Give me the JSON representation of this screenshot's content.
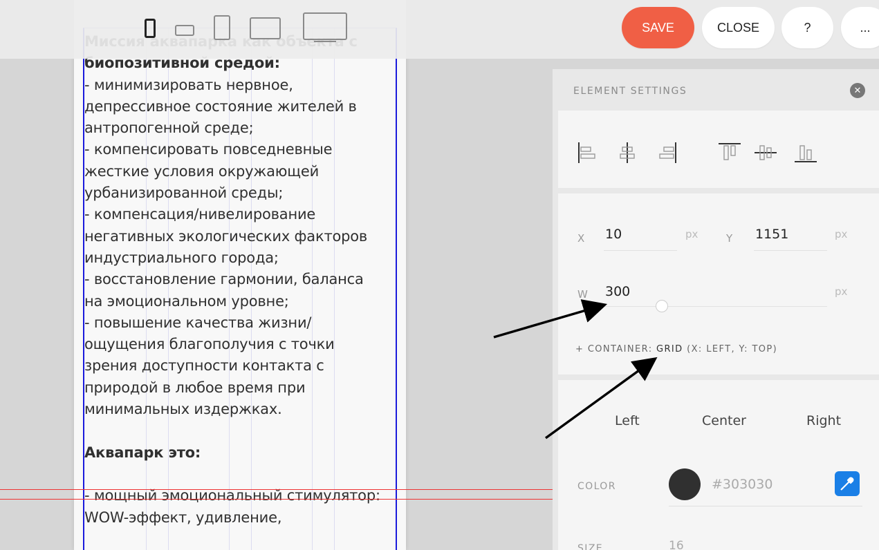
{
  "canvas": {
    "text_title": "Миссия аквапарка как объекта с\nбиопозитивной средой:",
    "text_body1": "\n- минимизировать нервное,\nдепрессивное состояние жителей в\nантропогенной среде;\n- компенсировать повседневные\nжесткие условия окружающей\nурбанизированной среды;\n- компенсация/нивелирование\nнегативных экологических факторов\nиндустриального города;\n- восстановление гармонии, баланса\nна эмоциональном уровне;\n- повышение качества жизни/\nощущения благополучия с точки\nзрения доступности контакта с\nприродой в любое время при\nминимальных издержках.\n",
    "text_heading2": "\nАквапарк это:",
    "text_body2": "\n\n- мощный эмоциональный стимулятор:\nWOW-эффект, удивление,"
  },
  "topbar": {
    "devices": [
      "phone-icon",
      "phone-landscape-icon",
      "tablet-icon",
      "tablet-landscape-icon",
      "desktop-icon"
    ],
    "save_label": "SAVE",
    "close_label": "CLOSE",
    "help_label": "?",
    "more_label": "..."
  },
  "panel": {
    "title": "ELEMENT SETTINGS",
    "close_glyph": "✕",
    "position": {
      "x_label": "X",
      "x_value": "10",
      "x_unit": "px",
      "y_label": "Y",
      "y_value": "1151",
      "y_unit": "px",
      "w_label": "W",
      "w_value": "300",
      "w_unit": "px",
      "w_slider_fraction": 0.38
    },
    "container_prefix": "+ CONTAINER: ",
    "container_value": "GRID",
    "container_suffix": " (X: LEFT, Y: TOP)",
    "tabs": [
      "Left",
      "Center",
      "Right"
    ],
    "color_label": "COLOR",
    "color_value": "#303030",
    "size_label": "SIZE",
    "size_value": "16"
  },
  "colors": {
    "save": "#f05f45",
    "guide_red": "#e33333",
    "frame_blue": "#1a1adc",
    "picker_blue": "#1a7fe6",
    "text": "#303030"
  }
}
